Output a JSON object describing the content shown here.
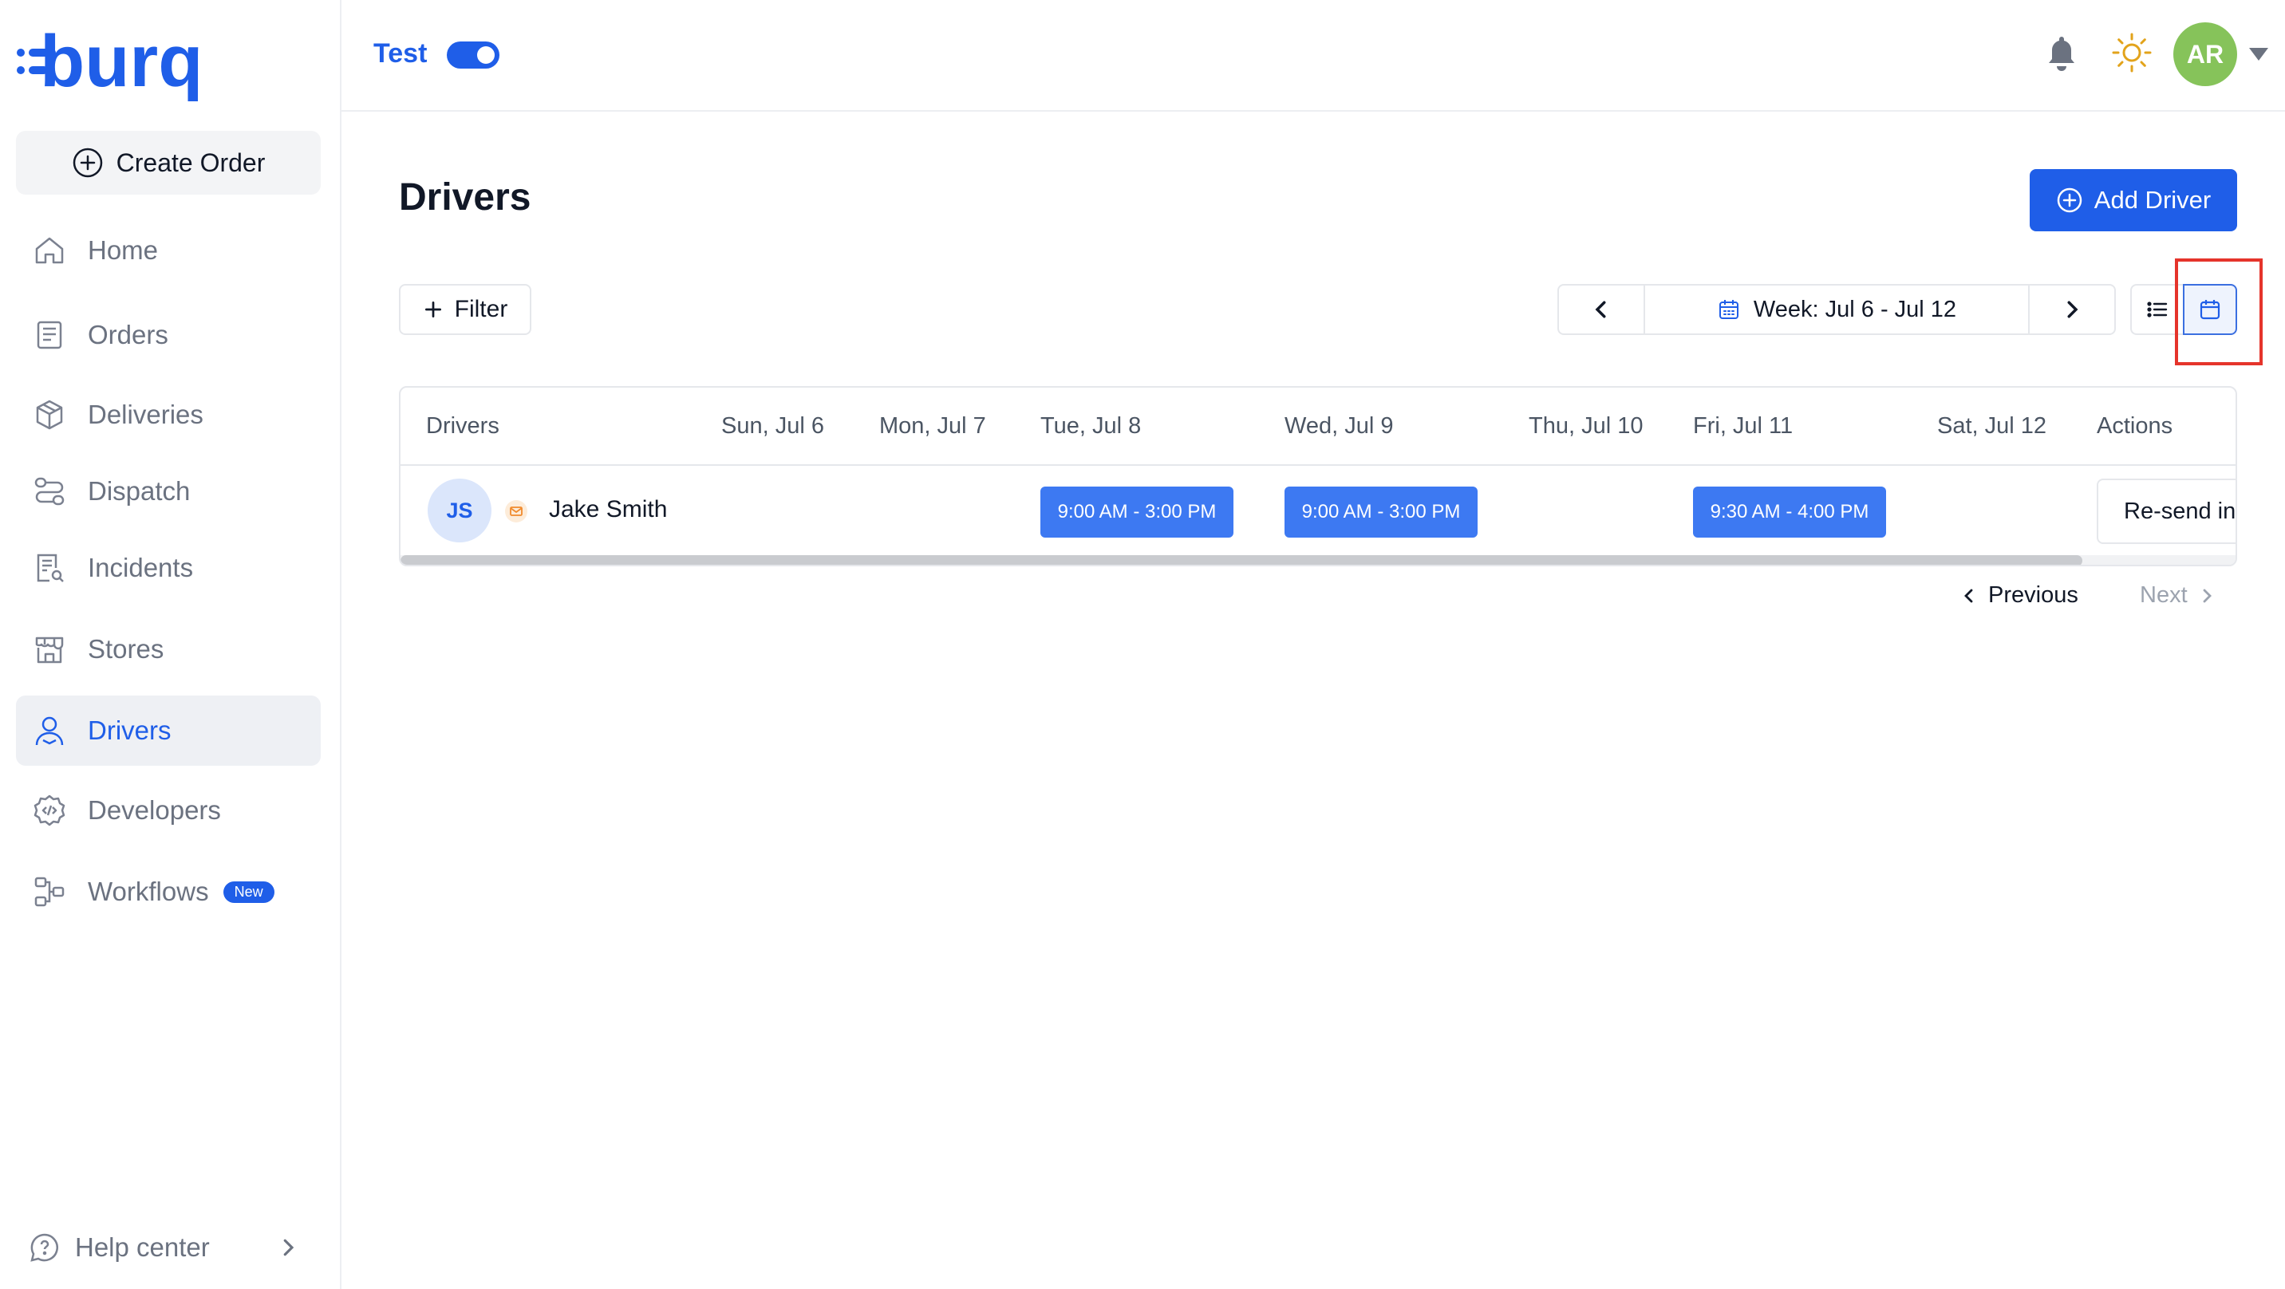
{
  "brand": {
    "name": "burq",
    "color": "#1f5ee8"
  },
  "sidebar": {
    "create_order": "Create Order",
    "items": [
      {
        "label": "Home",
        "icon": "home-icon"
      },
      {
        "label": "Orders",
        "icon": "orders-icon"
      },
      {
        "label": "Deliveries",
        "icon": "box-icon"
      },
      {
        "label": "Dispatch",
        "icon": "route-icon"
      },
      {
        "label": "Incidents",
        "icon": "document-search-icon"
      },
      {
        "label": "Stores",
        "icon": "store-icon"
      },
      {
        "label": "Drivers",
        "icon": "user-icon",
        "active": true
      },
      {
        "label": "Developers",
        "icon": "code-gear-icon"
      },
      {
        "label": "Workflows",
        "icon": "workflow-icon",
        "badge": "New"
      }
    ],
    "help": "Help center"
  },
  "header": {
    "env_label": "Test",
    "env_toggle_on": true,
    "avatar_initials": "AR",
    "avatar_color": "#86c35a"
  },
  "main": {
    "title": "Drivers",
    "add_driver": "Add Driver",
    "filter": "Filter",
    "week_label": "Week: Jul 6 - Jul 12",
    "columns": [
      "Drivers",
      "Sun, Jul 6",
      "Mon, Jul 7",
      "Tue, Jul 8",
      "Wed, Jul 9",
      "Thu, Jul 10",
      "Fri, Jul 11",
      "Sat, Jul 12",
      "Actions"
    ],
    "rows": [
      {
        "initials": "JS",
        "name": "Jake Smith",
        "shifts": {
          "tue": "9:00 AM - 3:00 PM",
          "wed": "9:00 AM - 3:00 PM",
          "fri": "9:30 AM - 4:00 PM"
        },
        "action": "Re-send invite"
      }
    ],
    "pagination": {
      "previous": "Previous",
      "next": "Next"
    }
  }
}
